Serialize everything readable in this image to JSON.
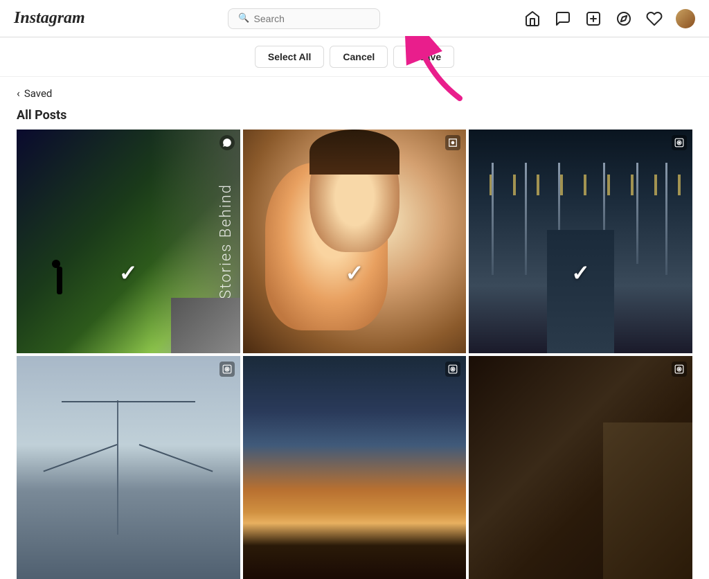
{
  "header": {
    "logo": "Instagram",
    "search": {
      "placeholder": "Search",
      "value": ""
    },
    "nav_icons": [
      {
        "name": "home-icon",
        "symbol": "⌂"
      },
      {
        "name": "messenger-icon",
        "symbol": "✉"
      },
      {
        "name": "create-icon",
        "symbol": "+"
      },
      {
        "name": "explore-icon",
        "symbol": "◎"
      },
      {
        "name": "heart-icon",
        "symbol": "♡"
      },
      {
        "name": "avatar-icon",
        "symbol": ""
      }
    ]
  },
  "action_bar": {
    "select_all_label": "Select All",
    "cancel_label": "Cancel",
    "unsave_label": "Unsave"
  },
  "saved_nav": {
    "back_label": "Saved"
  },
  "section": {
    "title": "All Posts"
  },
  "grid": {
    "items": [
      {
        "id": 1,
        "type": "photo_reel",
        "selected": true,
        "icon": "messenger"
      },
      {
        "id": 2,
        "type": "photo_reel",
        "selected": true,
        "icon": "reels"
      },
      {
        "id": 3,
        "type": "photo",
        "selected": true,
        "icon": "reels"
      },
      {
        "id": 4,
        "type": "photo_reel",
        "selected": false,
        "icon": "reels"
      },
      {
        "id": 5,
        "type": "photo_reel",
        "selected": false,
        "icon": "reels"
      },
      {
        "id": 6,
        "type": "photo_reel",
        "selected": false,
        "icon": "reels"
      }
    ]
  },
  "colors": {
    "accent": "#e91e8c",
    "border": "#dbdbdb",
    "text_primary": "#262626",
    "text_secondary": "#8e8e8e"
  }
}
